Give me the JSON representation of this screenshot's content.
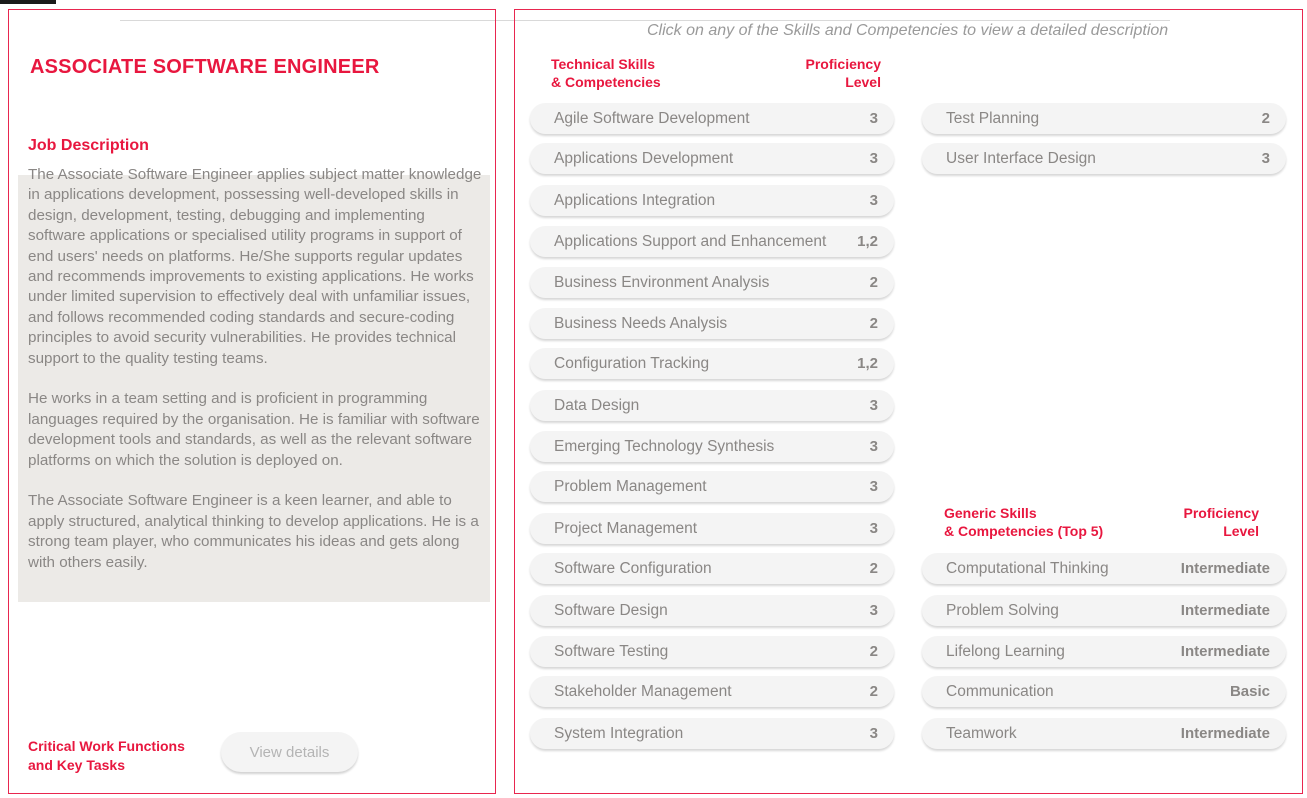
{
  "job_title": "ASSOCIATE SOFTWARE ENGINEER",
  "job_description": {
    "heading": "Job Description",
    "paragraphs": [
      "The Associate Software Engineer applies subject matter knowledge in applications development, possessing well-developed skills in design, development, testing, debugging and implementing software applications or specialised utility programs in support of end users' needs on platforms. He/She supports regular updates and recommends improvements to existing applications. He works under limited supervision to effectively deal with unfamiliar issues, and follows recommended coding standards and secure-coding principles to avoid security vulnerabilities. He provides technical support to the quality testing teams.",
      "He works in a team setting and is proficient in programming languages required by the organisation. He is familiar with software development tools and standards, as well as the relevant software platforms on which the solution is deployed on.",
      "The Associate Software Engineer is a keen learner, and able to apply structured, analytical thinking to develop applications. He is a strong team player, who communicates his ideas and gets along with others easily."
    ]
  },
  "critical_work": {
    "label_line1": "Critical Work Functions",
    "label_line2": "and Key Tasks",
    "button_label": "View details"
  },
  "instruction": "Click on any of the Skills and Competencies to view a detailed description",
  "technical_header": {
    "title_line1": "Technical Skills",
    "title_line2": "& Competencies",
    "level_line1": "Proficiency",
    "level_line2": "Level"
  },
  "technical_skills": [
    {
      "name": "Agile Software Development",
      "level": "3"
    },
    {
      "name": "Applications Development",
      "level": "3"
    },
    {
      "name": "Applications Integration",
      "level": "3"
    },
    {
      "name": "Applications Support and Enhancement",
      "level": "1,2"
    },
    {
      "name": "Business Environment Analysis",
      "level": "2"
    },
    {
      "name": "Business Needs Analysis",
      "level": "2"
    },
    {
      "name": "Configuration Tracking",
      "level": "1,2"
    },
    {
      "name": "Data Design",
      "level": "3"
    },
    {
      "name": "Emerging Technology Synthesis",
      "level": "3"
    },
    {
      "name": "Problem Management",
      "level": "3"
    },
    {
      "name": "Project Management",
      "level": "3"
    },
    {
      "name": "Software Configuration",
      "level": "2"
    },
    {
      "name": "Software Design",
      "level": "3"
    },
    {
      "name": "Software Testing",
      "level": "2"
    },
    {
      "name": "Stakeholder Management",
      "level": "2"
    },
    {
      "name": "System Integration",
      "level": "3"
    }
  ],
  "technical_skills_col2": [
    {
      "name": "Test Planning",
      "level": "2"
    },
    {
      "name": "User Interface Design",
      "level": "3"
    }
  ],
  "generic_header": {
    "title_line1": "Generic Skills",
    "title_line2": "& Competencies (Top 5)",
    "level_line1": "Proficiency",
    "level_line2": "Level"
  },
  "generic_skills": [
    {
      "name": "Computational Thinking",
      "level": "Intermediate"
    },
    {
      "name": "Problem Solving",
      "level": "Intermediate"
    },
    {
      "name": "Lifelong Learning",
      "level": "Intermediate"
    },
    {
      "name": "Communication",
      "level": "Basic"
    },
    {
      "name": "Teamwork",
      "level": "Intermediate"
    }
  ],
  "colors": {
    "accent": "#e8173f",
    "border": "#e8264f",
    "pill_bg": "#f4f4f4",
    "text_gray": "#8a8785",
    "description_bg": "#eceae7"
  }
}
